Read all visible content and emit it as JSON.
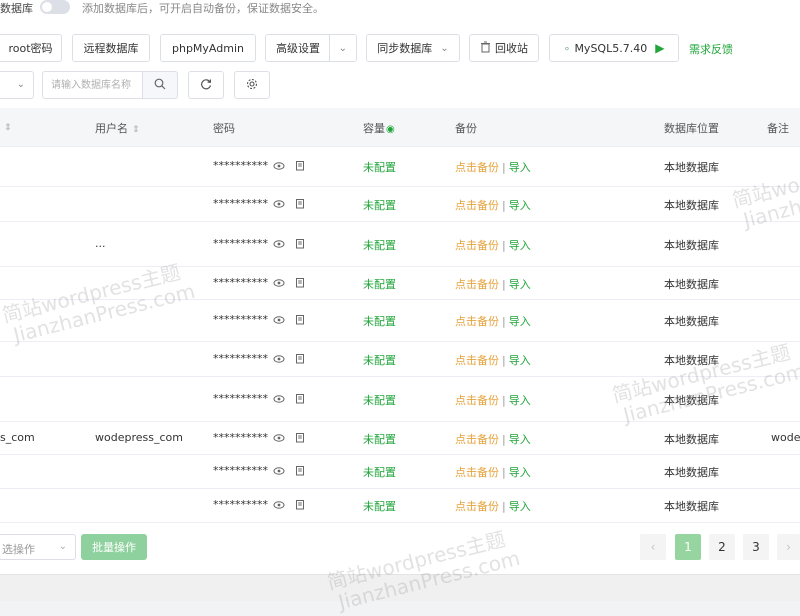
{
  "notice": {
    "label": "数据库",
    "text": "添加数据库后，可开启自动备份，保证数据安全。"
  },
  "toolbar": {
    "root_password": "root密码",
    "remote_db": "远程数据库",
    "phpmyadmin": "phpMyAdmin",
    "advanced": "高级设置",
    "sync_db": "同步数据库",
    "recycle_bin": "回收站",
    "mysql_version": "MySQL5.7.40",
    "feedback": "需求反馈"
  },
  "filter": {
    "search_placeholder": "请输入数据库名称"
  },
  "table": {
    "columns": {
      "name": "",
      "username": "用户名",
      "password": "密码",
      "capacity": "容量",
      "backup": "备份",
      "location": "数据库位置",
      "remark": "备注"
    },
    "rows": [
      {
        "name": "",
        "username": "",
        "password": "**********",
        "capacity": "未配置",
        "backup": "点击备份",
        "import": "导入",
        "location": "本地数据库",
        "remark": ""
      },
      {
        "name": "",
        "username": "",
        "password": "**********",
        "capacity": "未配置",
        "backup": "点击备份",
        "import": "导入",
        "location": "本地数据库",
        "remark": ""
      },
      {
        "name": "",
        "username": "...",
        "password": "**********",
        "capacity": "未配置",
        "backup": "点击备份",
        "import": "导入",
        "location": "本地数据库",
        "remark": ""
      },
      {
        "name": "",
        "username": "",
        "password": "**********",
        "capacity": "未配置",
        "backup": "点击备份",
        "import": "导入",
        "location": "本地数据库",
        "remark": ""
      },
      {
        "name": "",
        "username": "",
        "password": "**********",
        "capacity": "未配置",
        "backup": "点击备份",
        "import": "导入",
        "location": "本地数据库",
        "remark": ""
      },
      {
        "name": "",
        "username": "",
        "password": "**********",
        "capacity": "未配置",
        "backup": "点击备份",
        "import": "导入",
        "location": "本地数据库",
        "remark": ""
      },
      {
        "name": "",
        "username": "",
        "password": "**********",
        "capacity": "未配置",
        "backup": "点击备份",
        "import": "导入",
        "location": "本地数据库",
        "remark": ""
      },
      {
        "name": "s_com",
        "username": "wodepress_com",
        "password": "**********",
        "capacity": "未配置",
        "backup": "点击备份",
        "import": "导入",
        "location": "本地数据库",
        "remark": "wode"
      },
      {
        "name": "",
        "username": "",
        "password": "**********",
        "capacity": "未配置",
        "backup": "点击备份",
        "import": "导入",
        "location": "本地数据库",
        "remark": ""
      },
      {
        "name": "",
        "username": "",
        "password": "**********",
        "capacity": "未配置",
        "backup": "点击备份",
        "import": "导入",
        "location": "本地数据库",
        "remark": ""
      }
    ]
  },
  "footer": {
    "batch_select": "选操作",
    "batch_button": "批量操作",
    "pages": [
      "1",
      "2",
      "3"
    ],
    "current_page": "1"
  },
  "watermark": {
    "line1": "简站wordpress主题",
    "line2": "JianzhanPress.com"
  },
  "colors": {
    "accent": "#20a53a",
    "warning": "#e6a23c",
    "active_page": "#96d4a0",
    "batch_button": "#8fd19e"
  }
}
